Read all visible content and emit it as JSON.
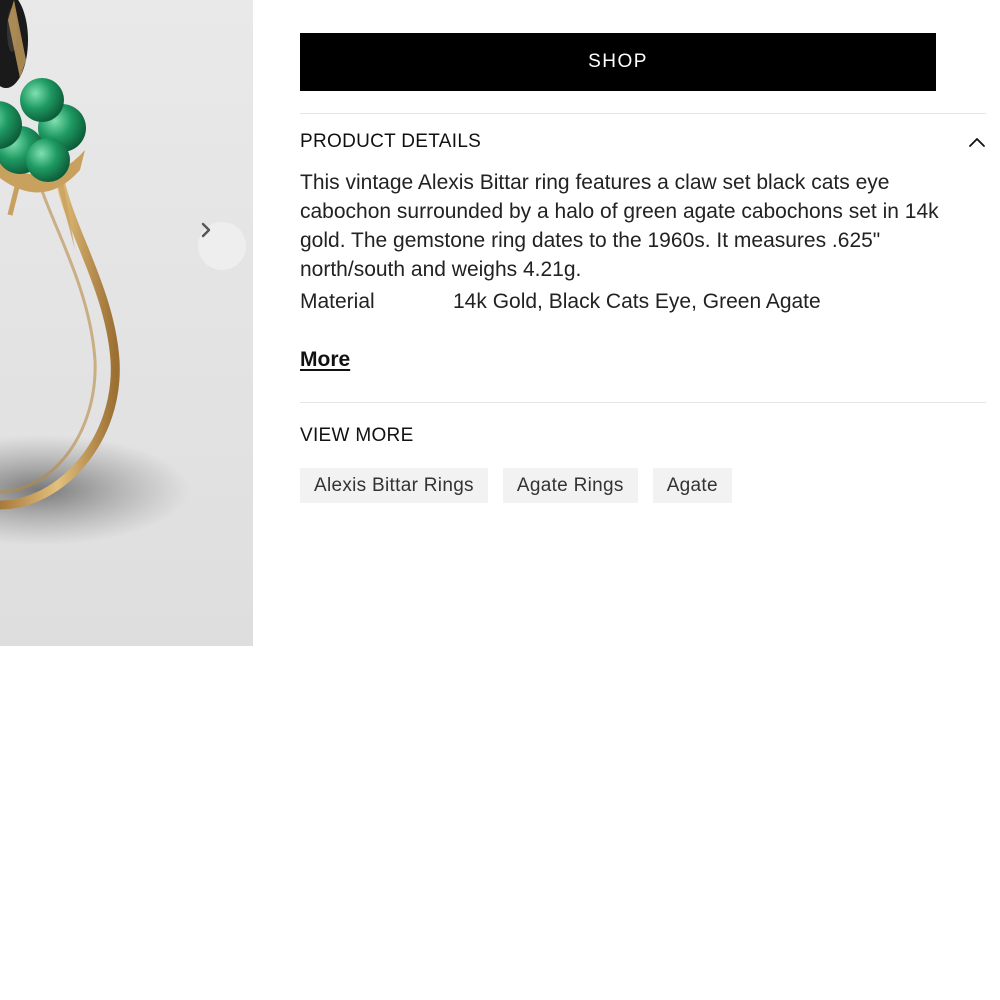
{
  "product_image": {
    "alt_icon": "product-photo-ring",
    "next_icon": "chevron-right-icon"
  },
  "shop_button": {
    "label": "SHOP"
  },
  "product_details": {
    "title": "PRODUCT DETAILS",
    "toggle_icon": "chevron-up-icon",
    "description": "This vintage Alexis Bittar ring features a claw set black cats eye cabochon surrounded by a halo of green agate cabochons set in 14k gold. The gemstone ring dates to the 1960s. It measures .625\" north/south and weighs 4.21g.",
    "attributes": [
      {
        "label": "Material",
        "value": "14k Gold, Black Cats Eye, Green Agate"
      }
    ],
    "more_label": "More"
  },
  "view_more": {
    "title": "VIEW MORE",
    "tags": [
      {
        "label": "Alexis Bittar Rings"
      },
      {
        "label": "Agate Rings"
      },
      {
        "label": "Agate"
      }
    ]
  },
  "colors": {
    "button_bg": "#000000",
    "button_text": "#ffffff",
    "tag_bg": "#f2f2f2",
    "image_bg": "#e8e8e8",
    "gold": "#c9a15e",
    "agate_green": "#1f9a63"
  }
}
